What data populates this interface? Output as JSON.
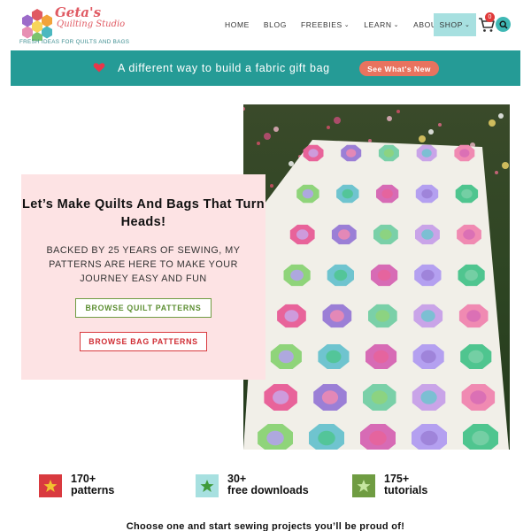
{
  "header": {
    "logo": {
      "name": "Geta's",
      "sub": "Quilting Studio",
      "tagline": "FRESH IDEAS FOR QUILTS AND BAGS"
    },
    "nav": [
      {
        "label": "HOME",
        "dropdown": false
      },
      {
        "label": "BLOG",
        "dropdown": false
      },
      {
        "label": "FREEBIES",
        "dropdown": true
      },
      {
        "label": "LEARN",
        "dropdown": true
      },
      {
        "label": "ABOUT",
        "dropdown": false
      }
    ],
    "shop_label": "SHOP",
    "cart_count": "0"
  },
  "banner": {
    "text": "A different way to build a fabric gift bag",
    "button": "See What's New"
  },
  "hero": {
    "title": "Let’s Make Quilts And Bags That Turn Heads!",
    "subtitle": "BACKED BY 25 YEARS OF SEWING, MY PATTERNS ARE HERE TO MAKE YOUR JOURNEY EASY AND FUN",
    "quilt_button": "BROWSE QUILT PATTERNS",
    "bag_button": "BROWSE BAG PATTERNS"
  },
  "stats": [
    {
      "number": "170+",
      "label": "patterns",
      "color": "#d93a3f"
    },
    {
      "number": "30+",
      "label": "free downloads",
      "color": "#a7e0e0"
    },
    {
      "number": "175+",
      "label": "tutorials",
      "color": "#6f9c42"
    }
  ],
  "cta": "Choose one and start sewing projects you’ll be proud of!",
  "colors": {
    "teal": "#259b96",
    "pink_card": "#fde3e4",
    "coral": "#e8735f",
    "green": "#6f9c42",
    "red": "#d93a3f"
  }
}
